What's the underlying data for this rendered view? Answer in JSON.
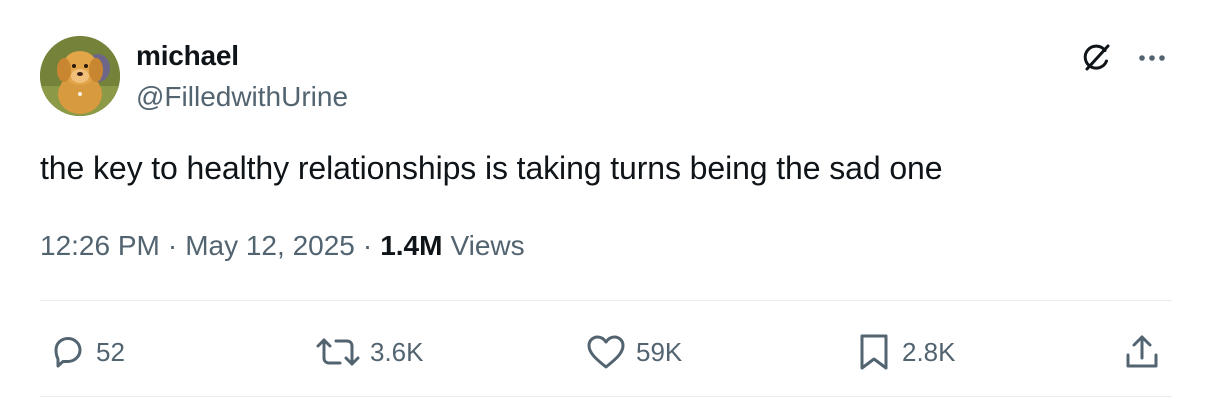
{
  "author": {
    "display_name": "michael",
    "handle": "@FilledwithUrine"
  },
  "tweet": {
    "text": "the key to healthy relationships is taking turns being the sad one",
    "time": "12:26 PM",
    "separator": "·",
    "date": "May 12, 2025",
    "views_count": "1.4M",
    "views_label": "Views"
  },
  "actions": {
    "replies": "52",
    "reposts": "3.6K",
    "likes": "59K",
    "bookmarks": "2.8K"
  },
  "icons": {
    "top_right": [
      "grok-icon",
      "more-options-icon"
    ],
    "actions": [
      "reply-icon",
      "repost-icon",
      "like-icon",
      "bookmark-icon",
      "share-icon"
    ]
  },
  "colors": {
    "text": "#0f1419",
    "secondary": "#536471",
    "divider": "#e6ecf0"
  }
}
